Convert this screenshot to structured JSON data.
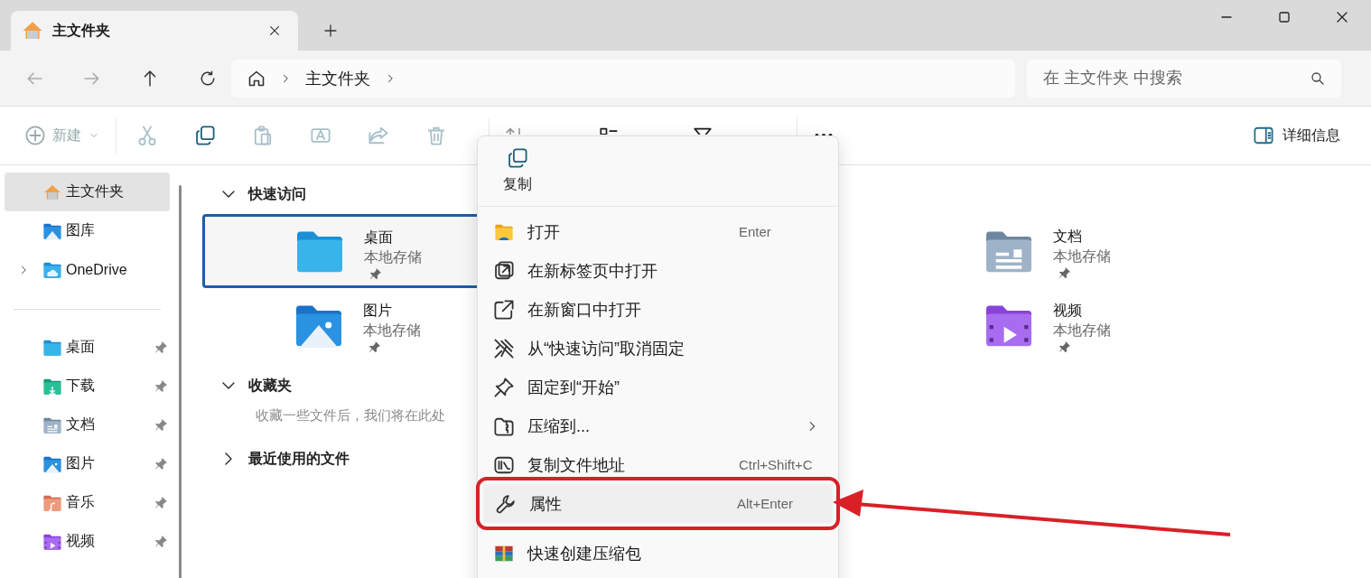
{
  "tab": {
    "title": "主文件夹",
    "selected": true
  },
  "address": {
    "crumbs": [
      "主文件夹"
    ]
  },
  "search": {
    "placeholder": "在 主文件夹 中搜索"
  },
  "toolbar": {
    "new": {
      "label": "新建",
      "disabled": true
    },
    "buttons": [
      {
        "kind": "cut",
        "disabled": true
      },
      {
        "kind": "copy",
        "disabled": false
      },
      {
        "kind": "paste",
        "disabled": true
      },
      {
        "kind": "rename",
        "disabled": true
      },
      {
        "kind": "share",
        "disabled": true
      },
      {
        "kind": "delete",
        "disabled": true
      }
    ],
    "views": [
      {
        "kind": "sort",
        "disabled": true
      },
      {
        "kind": "view",
        "disabled": false
      },
      {
        "kind": "filter",
        "disabled": false
      }
    ],
    "details": "详细信息"
  },
  "sidebar": {
    "items": [
      {
        "kind": "home",
        "label": "主文件夹",
        "selected": true
      },
      {
        "kind": "gallery",
        "label": "图库",
        "selected": false
      },
      {
        "kind": "onedrive",
        "label": "OneDrive",
        "selected": false,
        "expanded": false
      }
    ],
    "pinned": [
      {
        "kind": "desktop",
        "label": "桌面",
        "pinned": true,
        "selected": false
      },
      {
        "kind": "downloads",
        "label": "下载",
        "pinned": true,
        "selected": false
      },
      {
        "kind": "documents",
        "label": "文档",
        "pinned": true,
        "selected": false
      },
      {
        "kind": "pictures",
        "label": "图片",
        "pinned": true,
        "selected": false
      },
      {
        "kind": "music",
        "label": "音乐",
        "pinned": true,
        "selected": false
      },
      {
        "kind": "videos",
        "label": "视频",
        "pinned": true,
        "selected": false
      }
    ]
  },
  "sections": [
    {
      "title": "快速访问",
      "expanded": true,
      "items": [
        {
          "kind": "desktop",
          "name": "桌面",
          "location": "本地存储",
          "pinned": true,
          "selected": true
        },
        {
          "kind": "documents",
          "name": "文档",
          "location": "本地存储",
          "pinned": true,
          "selected": false
        },
        {
          "kind": "pictures",
          "name": "图片",
          "location": "本地存储",
          "pinned": true,
          "selected": false
        },
        {
          "kind": "videos",
          "name": "视频",
          "location": "本地存储",
          "pinned": true,
          "selected": false
        }
      ]
    },
    {
      "title": "收藏夹",
      "expanded": true,
      "message": "收藏一些文件后，我们将在此处"
    },
    {
      "title": "最近使用的文件",
      "expanded": false
    }
  ],
  "context_menu": {
    "top": [
      {
        "kind": "copy",
        "label": "复制"
      }
    ],
    "items": [
      {
        "kind": "open",
        "label": "打开",
        "shortcut": "Enter",
        "submenu": false,
        "highlighted": false
      },
      {
        "kind": "newtab",
        "label": "在新标签页中打开",
        "submenu": false,
        "highlighted": false
      },
      {
        "kind": "newwindow",
        "label": "在新窗口中打开",
        "submenu": false,
        "highlighted": false
      },
      {
        "kind": "unpin",
        "label": "从“快速访问”取消固定",
        "submenu": false,
        "highlighted": false
      },
      {
        "kind": "pinstart",
        "label": "固定到“开始”",
        "submenu": false,
        "highlighted": false
      },
      {
        "kind": "compress",
        "label": "压缩到...",
        "submenu": true,
        "highlighted": false
      },
      {
        "kind": "copypath",
        "label": "复制文件地址",
        "shortcut": "Ctrl+Shift+C",
        "submenu": false,
        "highlighted": false
      },
      {
        "kind": "properties",
        "label": "属性",
        "shortcut": "Alt+Enter",
        "submenu": false,
        "highlighted": true
      },
      {
        "kind": "archive",
        "label": "快速创建压缩包",
        "submenu": false,
        "highlighted": false
      }
    ]
  }
}
